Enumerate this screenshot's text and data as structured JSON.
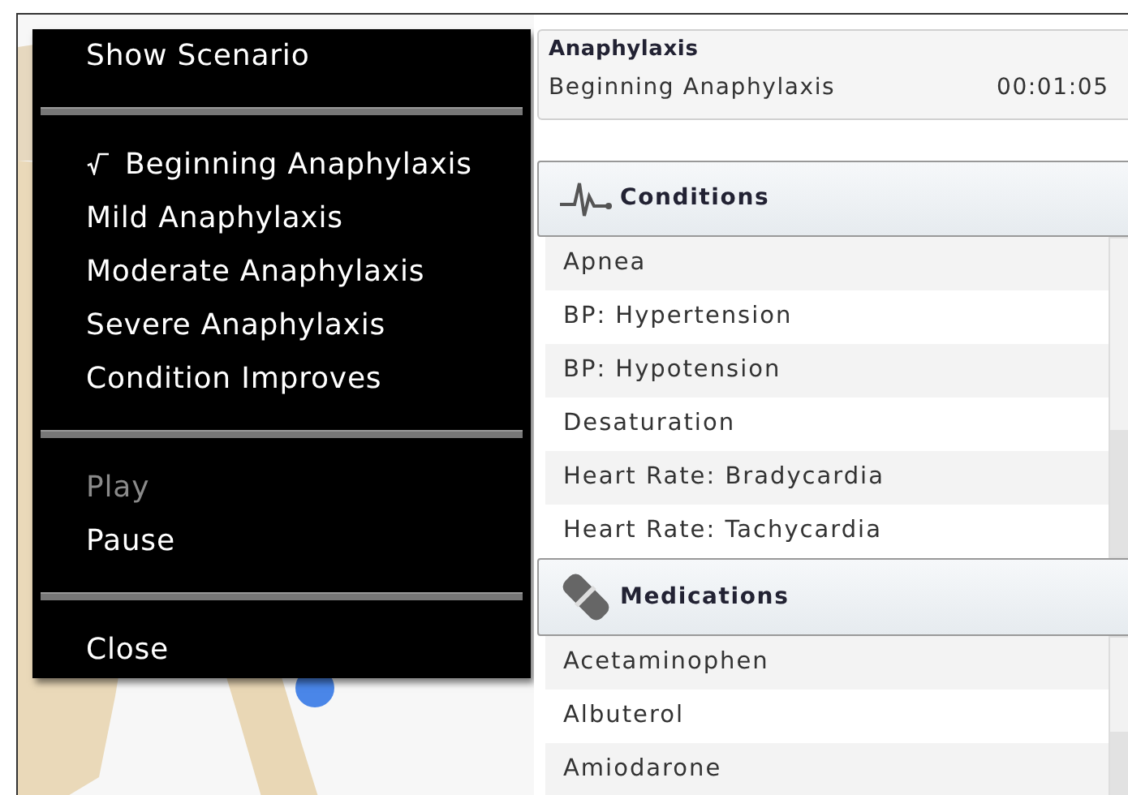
{
  "menu": {
    "items": [
      {
        "kind": "item",
        "label": "Show Scenario",
        "checked": false,
        "disabled": false
      },
      {
        "kind": "separator"
      },
      {
        "kind": "item",
        "label": "Beginning Anaphylaxis",
        "checked": true,
        "disabled": false
      },
      {
        "kind": "item",
        "label": "Mild Anaphylaxis",
        "checked": false,
        "disabled": false
      },
      {
        "kind": "item",
        "label": "Moderate Anaphylaxis",
        "checked": false,
        "disabled": false
      },
      {
        "kind": "item",
        "label": "Severe Anaphylaxis",
        "checked": false,
        "disabled": false
      },
      {
        "kind": "item",
        "label": "Condition Improves",
        "checked": false,
        "disabled": false
      },
      {
        "kind": "separator"
      },
      {
        "kind": "item",
        "label": "Play",
        "checked": false,
        "disabled": true
      },
      {
        "kind": "item",
        "label": "Pause",
        "checked": false,
        "disabled": false
      },
      {
        "kind": "separator"
      },
      {
        "kind": "item",
        "label": "Close",
        "checked": false,
        "disabled": false
      }
    ]
  },
  "scenario": {
    "title": "Anaphylaxis",
    "stage": "Beginning Anaphylaxis",
    "elapsed": "00:01:05"
  },
  "sections": [
    {
      "kind": "conditions",
      "title": "Conditions",
      "items": [
        "Apnea",
        "BP: Hypertension",
        "BP: Hypotension",
        "Desaturation",
        "Heart Rate: Bradycardia",
        "Heart Rate: Tachycardia"
      ]
    },
    {
      "kind": "medications",
      "title": "Medications",
      "items": [
        "Acetaminophen",
        "Albuterol",
        "Amiodarone"
      ]
    }
  ]
}
